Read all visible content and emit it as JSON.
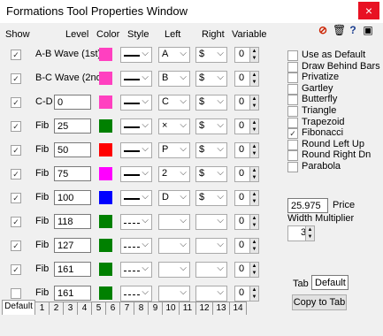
{
  "window": {
    "title": "Formations Tool Properties Window",
    "close": "×"
  },
  "headers": {
    "show": "Show",
    "level": "Level",
    "color": "Color",
    "style": "Style",
    "left": "Left",
    "right": "Right",
    "variable": "Variable"
  },
  "rows": [
    {
      "show": true,
      "label": "A-B Wave (1st)",
      "level": "",
      "color": "#ff40c0",
      "style": "solid",
      "left": "A",
      "right": "$",
      "variable": "0"
    },
    {
      "show": true,
      "label": "B-C Wave (2nd)",
      "level": "",
      "color": "#ff40c0",
      "style": "solid",
      "left": "B",
      "right": "$",
      "variable": "0"
    },
    {
      "show": true,
      "label": "C-D",
      "level": "0",
      "color": "#ff40c0",
      "style": "solid",
      "left": "C",
      "right": "$",
      "variable": "0"
    },
    {
      "show": true,
      "label": "Fib",
      "level": "25",
      "color": "#008000",
      "style": "solid",
      "left": "×",
      "right": "$",
      "variable": "0"
    },
    {
      "show": true,
      "label": "Fib",
      "level": "50",
      "color": "#ff0000",
      "style": "solid",
      "left": "P",
      "right": "$",
      "variable": "0"
    },
    {
      "show": true,
      "label": "Fib",
      "level": "75",
      "color": "#ff00ff",
      "style": "solid",
      "left": "2",
      "right": "$",
      "variable": "0"
    },
    {
      "show": true,
      "label": "Fib",
      "level": "100",
      "color": "#0000ff",
      "style": "solid",
      "left": "D",
      "right": "$",
      "variable": "0"
    },
    {
      "show": true,
      "label": "Fib",
      "level": "118",
      "color": "#008000",
      "style": "dashed",
      "left": "",
      "right": "",
      "variable": "0"
    },
    {
      "show": true,
      "label": "Fib",
      "level": "127",
      "color": "#008000",
      "style": "dashed",
      "left": "",
      "right": "",
      "variable": "0"
    },
    {
      "show": true,
      "label": "Fib",
      "level": "161",
      "color": "#008000",
      "style": "dashed",
      "left": "",
      "right": "",
      "variable": "0"
    },
    {
      "show": false,
      "label": "Fib",
      "level": "161",
      "color": "#008000",
      "style": "dashed",
      "left": "",
      "right": "",
      "variable": "0"
    }
  ],
  "options": [
    {
      "label": "Use as Default",
      "checked": false
    },
    {
      "label": "Draw Behind Bars",
      "checked": false
    },
    {
      "label": "Privatize",
      "checked": false
    },
    {
      "label": "Gartley",
      "checked": false
    },
    {
      "label": "Butterfly",
      "checked": false
    },
    {
      "label": "Triangle",
      "checked": false
    },
    {
      "label": "Trapezoid",
      "checked": false
    },
    {
      "label": "Fibonacci",
      "checked": true
    },
    {
      "label": "Round Left Up",
      "checked": false
    },
    {
      "label": "Round Right Dn",
      "checked": false
    },
    {
      "label": "Parabola",
      "checked": false
    }
  ],
  "price": {
    "value": "25.975",
    "label": "Price"
  },
  "width_multiplier": {
    "label": "Width Multiplier",
    "value": "3"
  },
  "tab_field": {
    "label": "Tab",
    "value": "Default"
  },
  "copy_button": "Copy to Tab",
  "tabs": [
    "Default",
    "1",
    "2",
    "3",
    "4",
    "5",
    "6",
    "7",
    "8",
    "9",
    "10",
    "11",
    "12",
    "13",
    "14"
  ],
  "toolbar_icons": [
    "no-entry-icon",
    "trash-icon",
    "help-icon",
    "camera-icon"
  ]
}
